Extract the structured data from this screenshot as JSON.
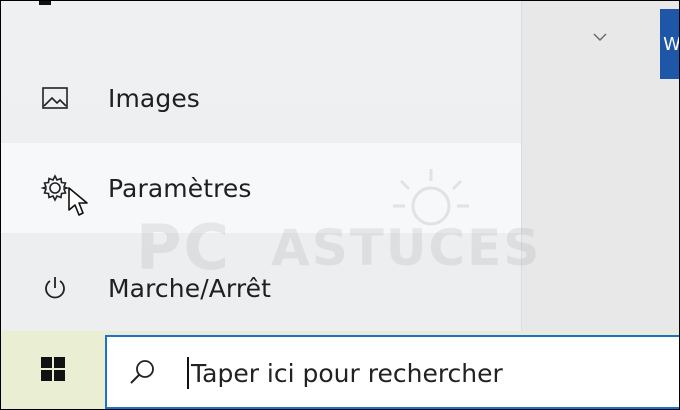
{
  "start_menu": {
    "items": [
      {
        "label": "Images",
        "icon": "image-icon"
      },
      {
        "label": "Paramètres",
        "icon": "gear-icon"
      },
      {
        "label": "Marche/Arrêt",
        "icon": "power-icon"
      }
    ]
  },
  "right_panel": {
    "tile_letter": "W"
  },
  "watermark": {
    "brand_left": "PC",
    "brand_right": "ASTUCES"
  },
  "taskbar": {
    "start_icon": "windows-logo-icon",
    "search": {
      "placeholder": "Taper ici pour rechercher",
      "icon": "search-icon"
    }
  },
  "colors": {
    "accent": "#1a73c8",
    "tile": "#1e56a8",
    "taskbar": "#eaeed3"
  }
}
